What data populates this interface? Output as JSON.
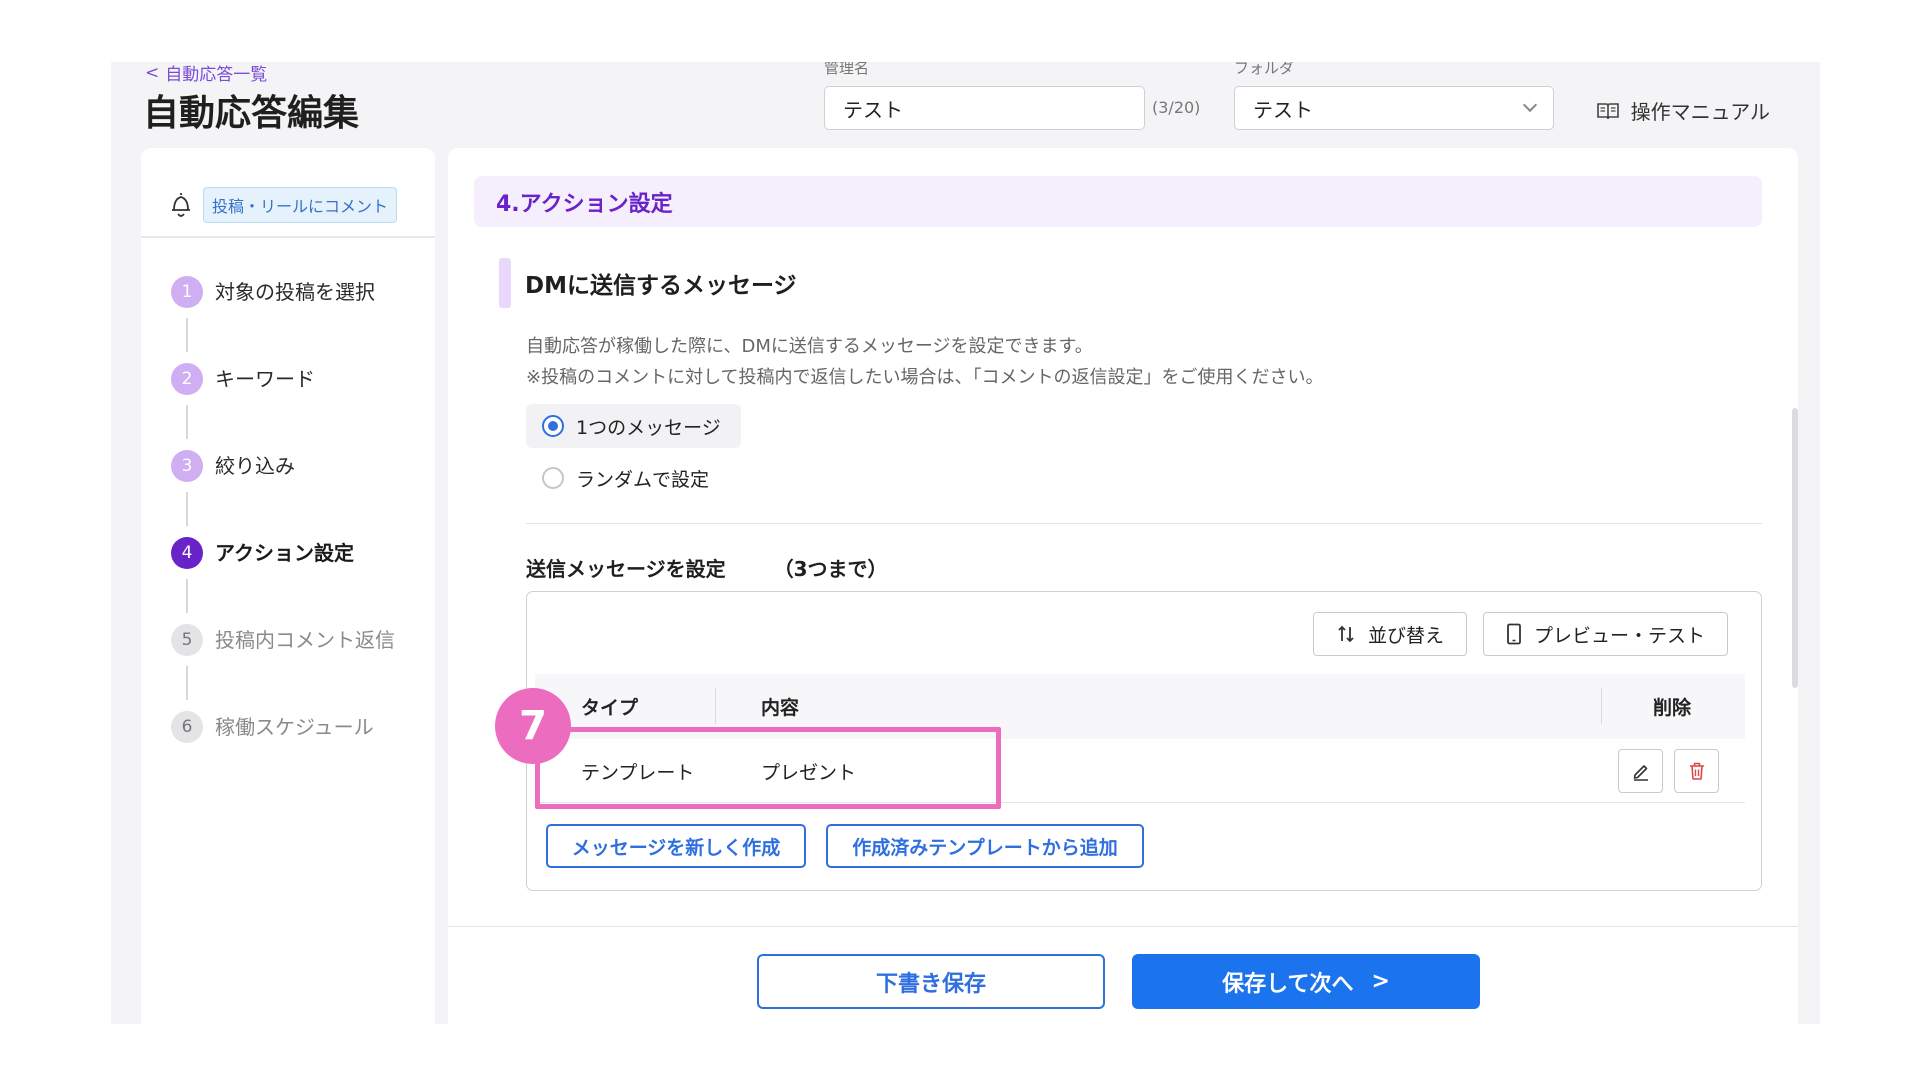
{
  "header": {
    "back_link": "自動応答一覧",
    "title": "自動応答編集",
    "name_label": "管理名",
    "name_value": "テスト",
    "name_counter": "(3/20)",
    "folder_label": "フォルダ",
    "folder_value": "テスト",
    "manual_label": "操作マニュアル"
  },
  "sidebar": {
    "trigger_badge": "投稿・リールにコメント",
    "steps": [
      {
        "num": "1",
        "label": "対象の投稿を選択",
        "state": "done"
      },
      {
        "num": "2",
        "label": "キーワード",
        "state": "done"
      },
      {
        "num": "3",
        "label": "絞り込み",
        "state": "done"
      },
      {
        "num": "4",
        "label": "アクション設定",
        "state": "current"
      },
      {
        "num": "5",
        "label": "投稿内コメント返信",
        "state": "todo"
      },
      {
        "num": "6",
        "label": "稼働スケジュール",
        "state": "todo"
      }
    ]
  },
  "main": {
    "section_title": "4.アクション設定",
    "sub_title": "DMに送信するメッセージ",
    "desc_line1": "自動応答が稼働した際に、DMに送信するメッセージを設定できます。",
    "desc_line2": "※投稿のコメントに対して投稿内で返信したい場合は、「コメントの返信設定」をご使用ください。",
    "radio_single": "1つのメッセージ",
    "radio_random": "ランダムで設定",
    "send_title": "送信メッセージを設定",
    "send_limit": "（3つまで）",
    "sort_button": "並び替え",
    "preview_button": "プレビュー・テスト",
    "table": {
      "col_type": "タイプ",
      "col_content": "内容",
      "col_delete": "削除",
      "rows": [
        {
          "type": "テンプレート",
          "content": "プレゼント"
        }
      ]
    },
    "new_message_button": "メッセージを新しく作成",
    "add_template_button": "作成済みテンプレートから追加",
    "draft_button": "下書き保存",
    "next_button": "保存して次へ"
  },
  "annotation": {
    "step_number": "7"
  },
  "colors": {
    "accent_purple": "#6a22c9",
    "primary_blue": "#1c73ee",
    "highlight_pink": "#ec6cbf"
  }
}
